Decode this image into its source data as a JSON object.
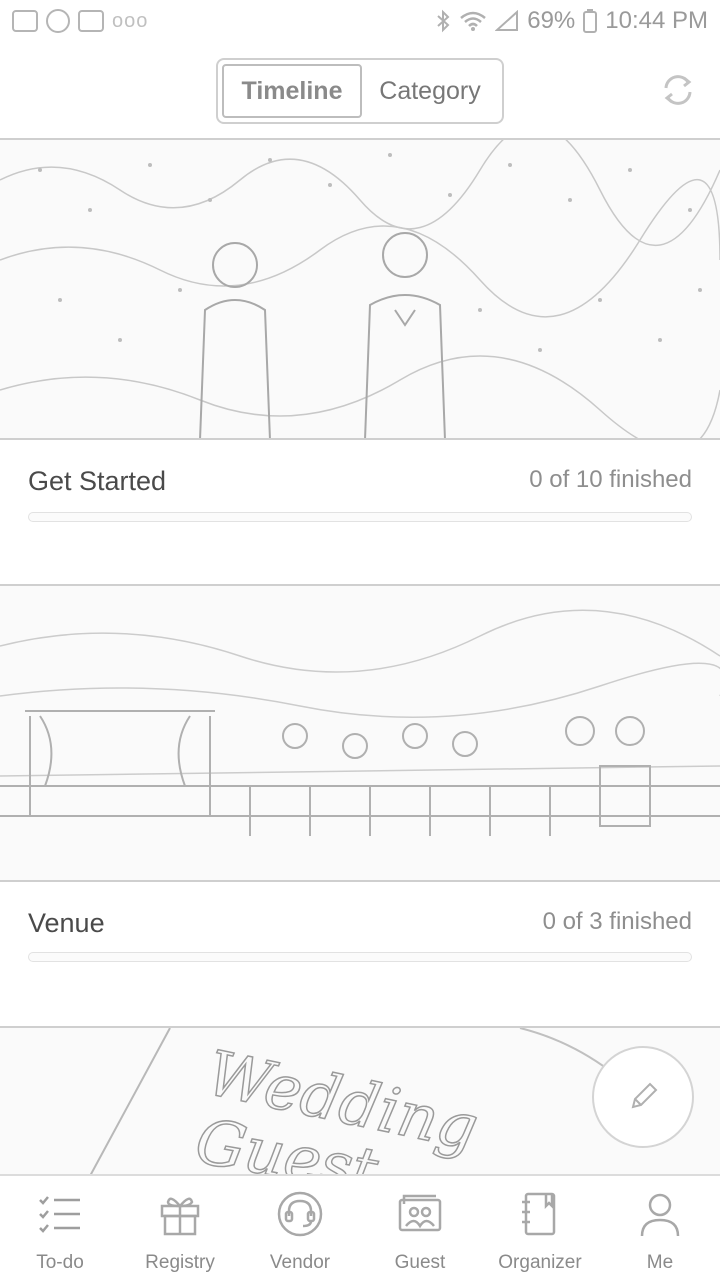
{
  "status_bar": {
    "battery": "69%",
    "time": "10:44 PM",
    "dots": "ooo"
  },
  "header": {
    "tabs": [
      {
        "label": "Timeline",
        "active": true
      },
      {
        "label": "Category",
        "active": false
      }
    ],
    "refresh_icon": "refresh-icon"
  },
  "cards": [
    {
      "title": "Get Started",
      "progress_text": "0 of 10 finished",
      "progress": 0,
      "image": "couple-confetti-photo"
    },
    {
      "title": "Venue",
      "progress_text": "0 of 3 finished",
      "progress": 0,
      "image": "beach-ceremony-photo"
    },
    {
      "image": "wedding-guest-script-image",
      "script_text": "Wedding Guest"
    }
  ],
  "fab": {
    "icon": "pencil-icon"
  },
  "bottom_nav": [
    {
      "label": "To-do",
      "icon": "checklist-icon"
    },
    {
      "label": "Registry",
      "icon": "gift-icon"
    },
    {
      "label": "Vendor",
      "icon": "headset-icon"
    },
    {
      "label": "Guest",
      "icon": "guests-icon"
    },
    {
      "label": "Organizer",
      "icon": "notebook-icon"
    },
    {
      "label": "Me",
      "icon": "person-icon"
    }
  ]
}
